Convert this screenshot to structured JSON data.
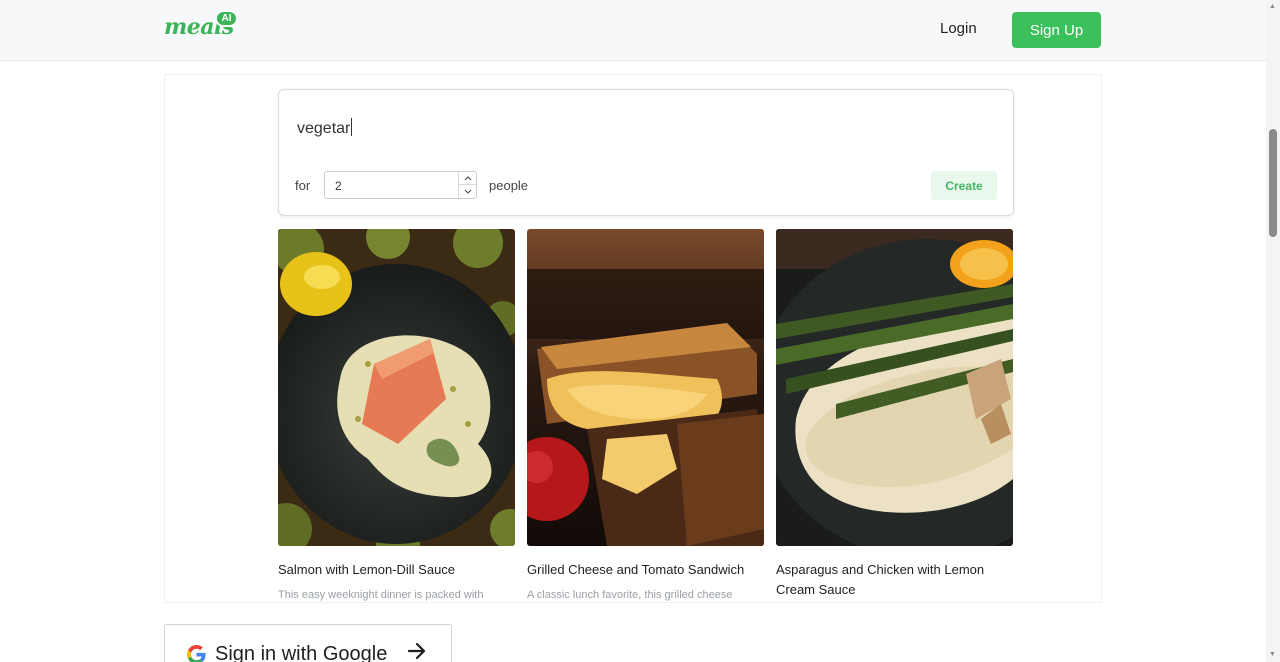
{
  "header": {
    "logo_word": "meals",
    "logo_badge": "AI",
    "login_label": "Login",
    "signup_label": "Sign Up"
  },
  "search": {
    "query": "vegetar",
    "for_label": "for",
    "servings": "2",
    "people_label": "people",
    "create_label": "Create"
  },
  "recipes": [
    {
      "title": "Salmon with Lemon-Dill Sauce",
      "description": "This easy weeknight dinner is packed with"
    },
    {
      "title": "Grilled Cheese and Tomato Sandwich",
      "description": "A classic lunch favorite, this grilled cheese"
    },
    {
      "title": "Asparagus and Chicken with Lemon Cream Sauce",
      "description": ""
    }
  ],
  "google": {
    "label": "Sign in with Google"
  },
  "colors": {
    "brand_green": "#3cc05b",
    "create_bg": "#e9f7ec"
  }
}
